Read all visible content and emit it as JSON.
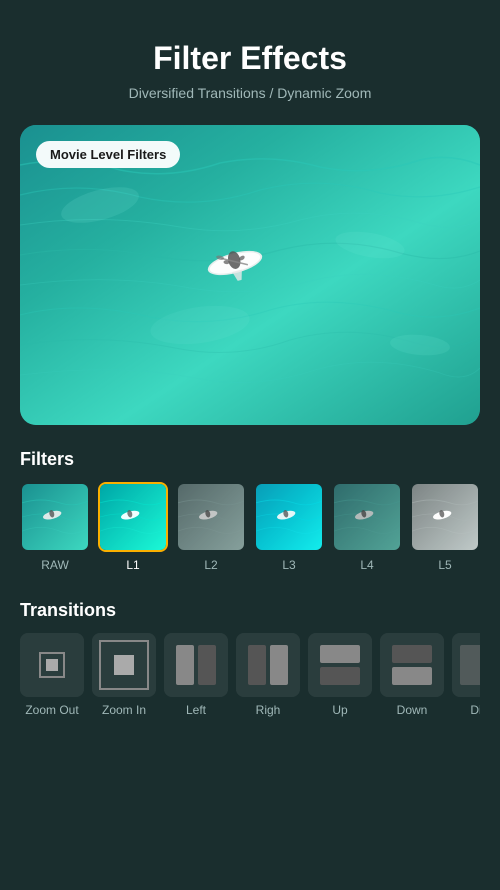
{
  "header": {
    "title": "Filter Effects",
    "subtitle": "Diversified Transitions / Dynamic Zoom"
  },
  "preview": {
    "badge_text": "Movie Level Filters"
  },
  "filters": {
    "section_title": "Filters",
    "items": [
      {
        "id": "raw",
        "label": "RAW",
        "selected": false,
        "color_style": "raw"
      },
      {
        "id": "l1",
        "label": "L1",
        "selected": true,
        "color_style": "l1"
      },
      {
        "id": "l2",
        "label": "L2",
        "selected": false,
        "color_style": "l2"
      },
      {
        "id": "l3",
        "label": "L3",
        "selected": false,
        "color_style": "l3"
      },
      {
        "id": "l4",
        "label": "L4",
        "selected": false,
        "color_style": "l4"
      },
      {
        "id": "l5",
        "label": "L5",
        "selected": false,
        "color_style": "l5"
      }
    ]
  },
  "transitions": {
    "section_title": "Transitions",
    "items": [
      {
        "id": "zoom-out",
        "label": "Zoom Out"
      },
      {
        "id": "zoom-in",
        "label": "Zoom In"
      },
      {
        "id": "left",
        "label": "Left"
      },
      {
        "id": "right",
        "label": "Righ"
      },
      {
        "id": "up",
        "label": "Up"
      },
      {
        "id": "down",
        "label": "Down"
      },
      {
        "id": "dissolve",
        "label": "Dis..."
      }
    ]
  }
}
